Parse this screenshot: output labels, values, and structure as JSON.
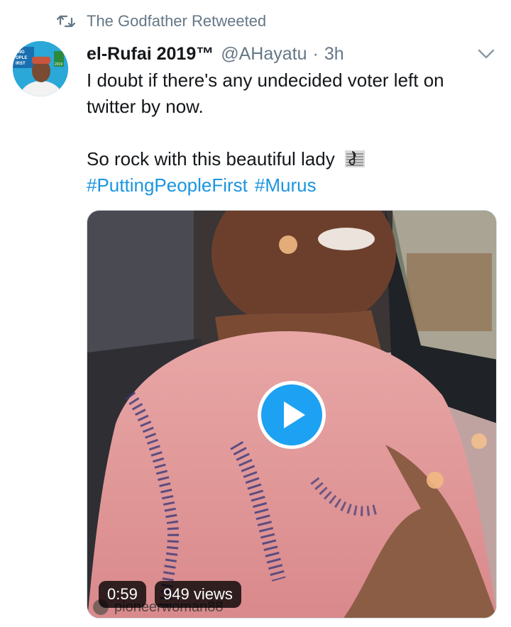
{
  "retweet": {
    "icon": "retweet-icon",
    "text": "The Godfather Retweeted"
  },
  "tweet": {
    "avatar": {
      "banner_text_1": "ING",
      "banner_text_2": "OPLE",
      "banner_text_3": "IRST",
      "badge_text": "2019"
    },
    "display_name": "el-Rufai 2019™",
    "handle": "@AHayatu",
    "separator": "·",
    "time": "3h",
    "line1": "I doubt if there's any undecided voter left on",
    "line2": "twitter by now.",
    "line3": "So rock with this beautiful lady",
    "emoji": "musical-score-icon",
    "hashtags": [
      "#PuttingPeopleFirst",
      "#Murus"
    ]
  },
  "media": {
    "duration": "0:59",
    "views": "949 views",
    "watermark": "pioneerwoman88",
    "play_icon": "play-icon"
  },
  "colors": {
    "accent": "#1da1f2",
    "hashtag": "#1b95e0",
    "muted": "#657786",
    "text": "#14171a"
  }
}
